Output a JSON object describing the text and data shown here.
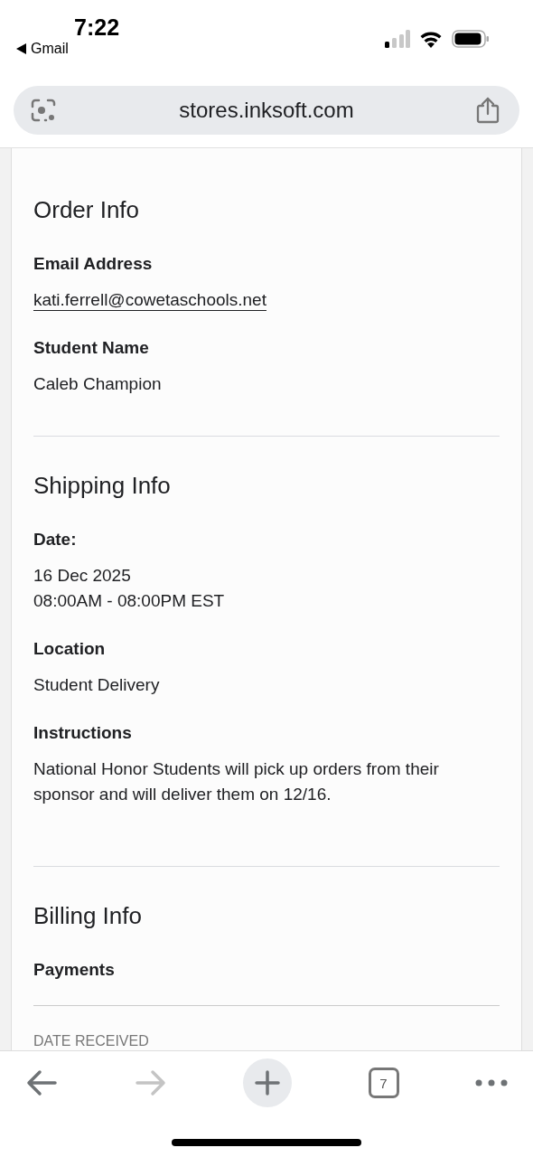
{
  "status_bar": {
    "time": "7:22",
    "back_app": "Gmail"
  },
  "url_bar": {
    "url": "stores.inksoft.com"
  },
  "sections": [
    {
      "title": "Order Info",
      "fields": [
        {
          "label": "Email Address",
          "kind": "link",
          "lines": [
            "kati.ferrell@cowetaschools.net"
          ]
        },
        {
          "label": "Student Name",
          "kind": "text",
          "lines": [
            "Caleb Champion"
          ]
        }
      ]
    },
    {
      "title": "Shipping Info",
      "fields": [
        {
          "label": "Date:",
          "kind": "text",
          "lines": [
            "16 Dec 2025",
            "08:00AM - 08:00PM EST"
          ]
        },
        {
          "label": "Location",
          "kind": "text",
          "lines": [
            "Student Delivery"
          ]
        },
        {
          "label": "Instructions",
          "kind": "text",
          "lines": [
            "National Honor Students will pick up orders from their sponsor and will deliver them on 12/16."
          ]
        }
      ]
    },
    {
      "title": "Billing Info",
      "fields": [
        {
          "label": "Payments",
          "kind": "heading"
        }
      ],
      "columns": [
        "DATE RECEIVED"
      ]
    }
  ],
  "toolbar": {
    "back_disabled": false,
    "forward_disabled": true,
    "tab_count": "7"
  }
}
